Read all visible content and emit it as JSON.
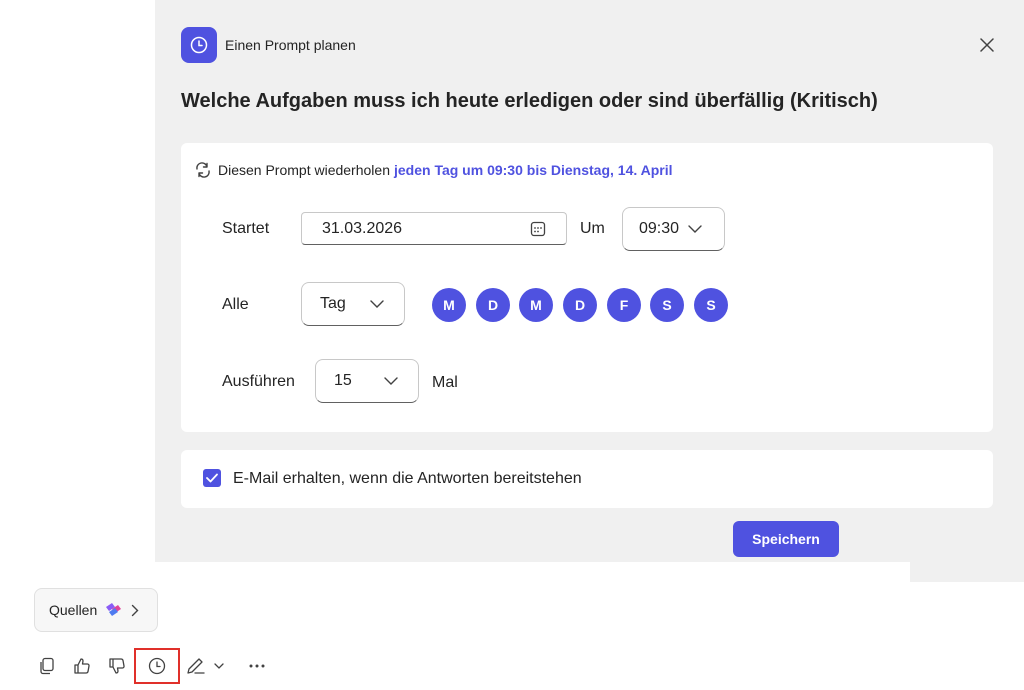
{
  "dialog": {
    "header_title": "Einen Prompt planen",
    "prompt_title": "Welche Aufgaben muss ich heute erledigen oder sind überfällig (Kritisch)",
    "repeat_label": "Diesen Prompt wiederholen",
    "repeat_summary": "jeden Tag um 09:30 bis Dienstag, 14. April",
    "start_label": "Startet",
    "start_date": "31.03.2026",
    "at_label": "Um",
    "start_time": "09:30",
    "every_label": "Alle",
    "frequency": "Tag",
    "days": [
      "M",
      "D",
      "M",
      "D",
      "F",
      "S",
      "S"
    ],
    "run_label": "Ausführen",
    "run_count": "15",
    "run_unit": "Mal",
    "email_label": "E-Mail erhalten, wenn die Antworten bereitstehen",
    "email_checked": true,
    "save_label": "Speichern"
  },
  "footer": {
    "sources_label": "Quellen"
  },
  "colors": {
    "accent": "#4f52e0",
    "panel_bg": "#f0f0f0",
    "highlight": "#e0302a"
  }
}
